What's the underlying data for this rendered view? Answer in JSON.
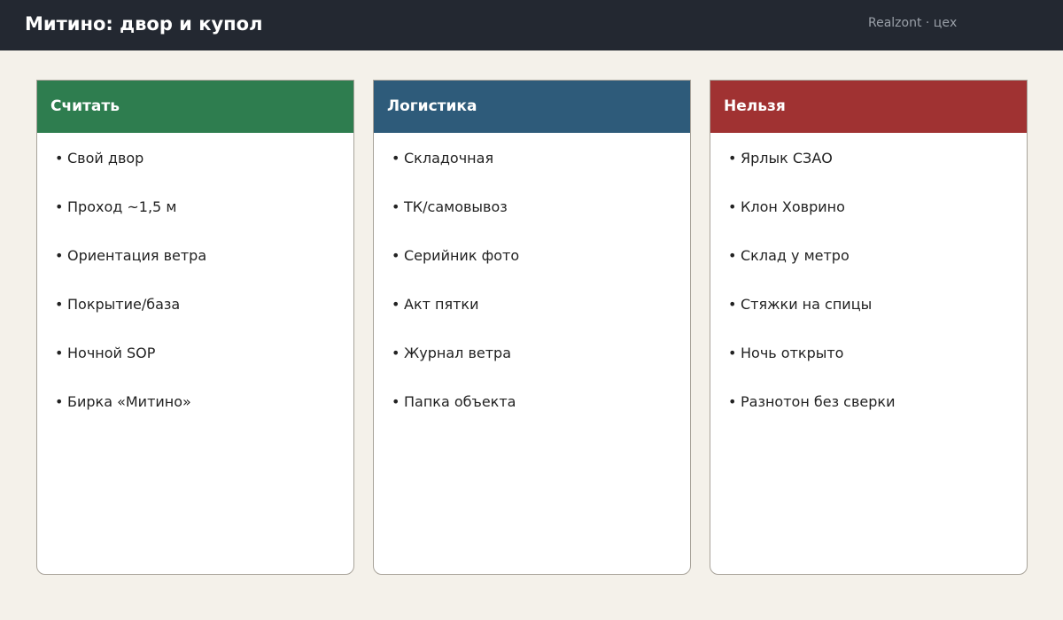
{
  "header": {
    "title": "Митино: двор и купол",
    "brand": "Realzont · цех"
  },
  "columns": [
    {
      "title": "Считать",
      "color": "#2e7d4f",
      "items": [
        "Свой двор",
        "Проход ~1,5 м",
        "Ориентация ветра",
        "Покрытие/база",
        "Ночной SOP",
        "Бирка «Митино»"
      ]
    },
    {
      "title": "Логистика",
      "color": "#2e5b7a",
      "items": [
        "Складочная",
        "ТК/самовывоз",
        "Серийник фото",
        "Акт пятки",
        "Журнал ветра",
        "Папка объекта"
      ]
    },
    {
      "title": "Нельзя",
      "color": "#a03232",
      "items": [
        "Ярлык СЗАО",
        "Клон Ховрино",
        "Склад у метро",
        "Стяжки на спицы",
        "Ночь открыто",
        "Разнотон без сверки"
      ]
    }
  ],
  "bullet": "•"
}
